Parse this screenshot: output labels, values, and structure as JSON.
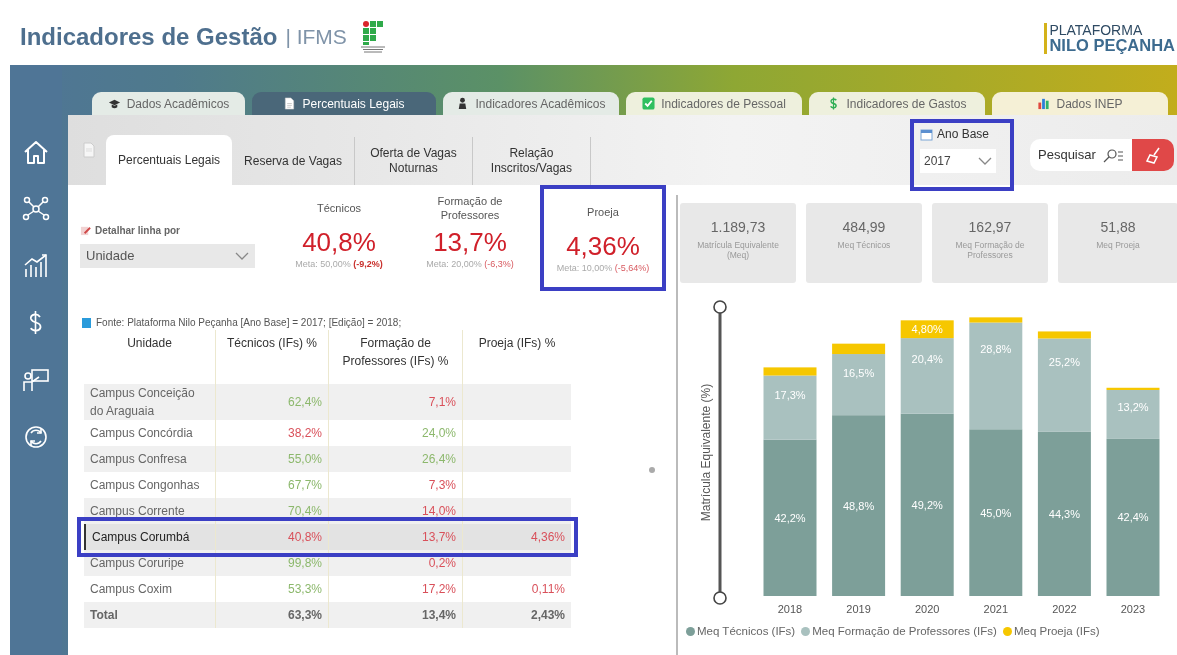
{
  "header": {
    "title": "Indicadores de Gestão",
    "org": "| IFMS",
    "brand_top": "PLATAFORMA",
    "brand_bottom": "NILO PEÇANHA"
  },
  "sidebar": {
    "items": [
      {
        "kind": "home"
      },
      {
        "kind": "network"
      },
      {
        "kind": "growth"
      },
      {
        "kind": "dollar"
      },
      {
        "kind": "teacher"
      },
      {
        "kind": "cycle"
      }
    ]
  },
  "tabs": [
    {
      "label": "Dados Acadêmicos",
      "selected": false
    },
    {
      "label": "Percentuais Legais",
      "selected": true
    },
    {
      "label": "Indicadores Acadêmicos",
      "selected": false
    },
    {
      "label": "Indicadores de Pessoal",
      "selected": false
    },
    {
      "label": "Indicadores de Gastos",
      "selected": false
    },
    {
      "label": "Dados INEP",
      "selected": false
    }
  ],
  "subtabs": [
    {
      "label": "Percentuais Legais",
      "selected": true
    },
    {
      "label": "Reserva de Vagas",
      "selected": false
    },
    {
      "label": "Oferta de Vagas Noturnas",
      "selected": false
    },
    {
      "label": "Relação Inscritos/Vagas",
      "selected": false
    }
  ],
  "year_filter": {
    "label": "Ano Base",
    "value": "2017",
    "annotated": true
  },
  "search": {
    "label": "Pesquisar"
  },
  "detail": {
    "label": "Detalhar linha por",
    "value": "Unidade"
  },
  "kpis": [
    {
      "title": "Técnicos",
      "value": "40,8%",
      "meta": "Meta: 50,00%",
      "delta": "(-9,2%)",
      "delta_bold": true,
      "annotated": false
    },
    {
      "title": "Formação de Professores",
      "value": "13,7%",
      "meta": "Meta: 20,00%",
      "delta": "(-6,3%)",
      "delta_bold": false,
      "annotated": false
    },
    {
      "title": "Proeja",
      "value": "4,36%",
      "meta": "Meta: 10,00%",
      "delta": "(-5,64%)",
      "delta_bold": false,
      "annotated": true
    }
  ],
  "source_note": "Fonte: Plataforma Nilo Peçanha [Ano Base] = 2017; [Edição] = 2018;",
  "table": {
    "columns": [
      "Unidade",
      "Técnicos (IFs) %",
      "Formação de Professores (IFs) %",
      "Proeja (IFs) %"
    ],
    "rows": [
      {
        "selected": false,
        "annotated": false,
        "cells": [
          {
            "text": "Campus Conceição do Araguaia"
          },
          {
            "text": "62,4%",
            "meets_target": true
          },
          {
            "text": "7,1%",
            "meets_target": false
          },
          null
        ]
      },
      {
        "selected": false,
        "annotated": false,
        "cells": [
          {
            "text": "Campus Concórdia"
          },
          {
            "text": "38,2%",
            "meets_target": false
          },
          {
            "text": "24,0%",
            "meets_target": true
          },
          null
        ]
      },
      {
        "selected": false,
        "annotated": false,
        "cells": [
          {
            "text": "Campus Confresa"
          },
          {
            "text": "55,0%",
            "meets_target": true
          },
          {
            "text": "26,4%",
            "meets_target": true
          },
          null
        ]
      },
      {
        "selected": false,
        "annotated": false,
        "cells": [
          {
            "text": "Campus Congonhas"
          },
          {
            "text": "67,7%",
            "meets_target": true
          },
          {
            "text": "7,3%",
            "meets_target": false
          },
          null
        ]
      },
      {
        "selected": false,
        "annotated": false,
        "cells": [
          {
            "text": "Campus Corrente"
          },
          {
            "text": "70,4%",
            "meets_target": true
          },
          {
            "text": "14,0%",
            "meets_target": false
          },
          null
        ]
      },
      {
        "selected": true,
        "annotated": true,
        "cells": [
          {
            "text": "Campus Corumbá"
          },
          {
            "text": "40,8%",
            "meets_target": false
          },
          {
            "text": "13,7%",
            "meets_target": false
          },
          {
            "text": "4,36%",
            "meets_target": false
          }
        ]
      },
      {
        "selected": false,
        "annotated": false,
        "cells": [
          {
            "text": "Campus Coruripe"
          },
          {
            "text": "99,8%",
            "meets_target": true
          },
          {
            "text": "0,2%",
            "meets_target": false
          },
          null
        ]
      },
      {
        "selected": false,
        "annotated": false,
        "cells": [
          {
            "text": "Campus Coxim"
          },
          {
            "text": "53,3%",
            "meets_target": true
          },
          {
            "text": "17,2%",
            "meets_target": false
          },
          {
            "text": "0,11%",
            "meets_target": false
          }
        ]
      }
    ],
    "total": [
      "Total",
      "63,3%",
      "13,4%",
      "2,43%"
    ]
  },
  "summary_cards": [
    {
      "value": "1.189,73",
      "label": "Matrícula Equivalente (Meq)"
    },
    {
      "value": "484,99",
      "label": "Meq Técnicos"
    },
    {
      "value": "162,97",
      "label": "Meq Formação de Professores"
    },
    {
      "value": "51,88",
      "label": "Meq Proeja"
    }
  ],
  "chart": {
    "chart_data": {
      "type": "bar",
      "stacked": true,
      "ylabel": "Matrícula Equivalente (%)",
      "categories": [
        "2018",
        "2019",
        "2020",
        "2021",
        "2022",
        "2023"
      ],
      "series": [
        {
          "name": "Meq Técnicos (IFs)",
          "color": "#7d9f99",
          "values": [
            42.2,
            48.8,
            49.2,
            45.0,
            44.3,
            42.4
          ],
          "value_labels": [
            "42,2%",
            "48,8%",
            "49,2%",
            "45,0%",
            "44,3%",
            "42,4%"
          ]
        },
        {
          "name": "Meq Formação de Professores (IFs)",
          "color": "#a9c1bf",
          "values": [
            17.3,
            16.5,
            20.4,
            28.8,
            25.2,
            13.2
          ],
          "value_labels": [
            "17,3%",
            "16,5%",
            "20,4%",
            "28,8%",
            "25,2%",
            "13,2%"
          ]
        },
        {
          "name": "Meq Proeja (IFs)",
          "color": "#f6c700",
          "values": [
            2.2,
            2.8,
            4.8,
            1.4,
            1.9,
            0.6
          ],
          "value_labels": [
            null,
            null,
            "4,80%",
            null,
            null,
            null
          ]
        }
      ]
    }
  }
}
